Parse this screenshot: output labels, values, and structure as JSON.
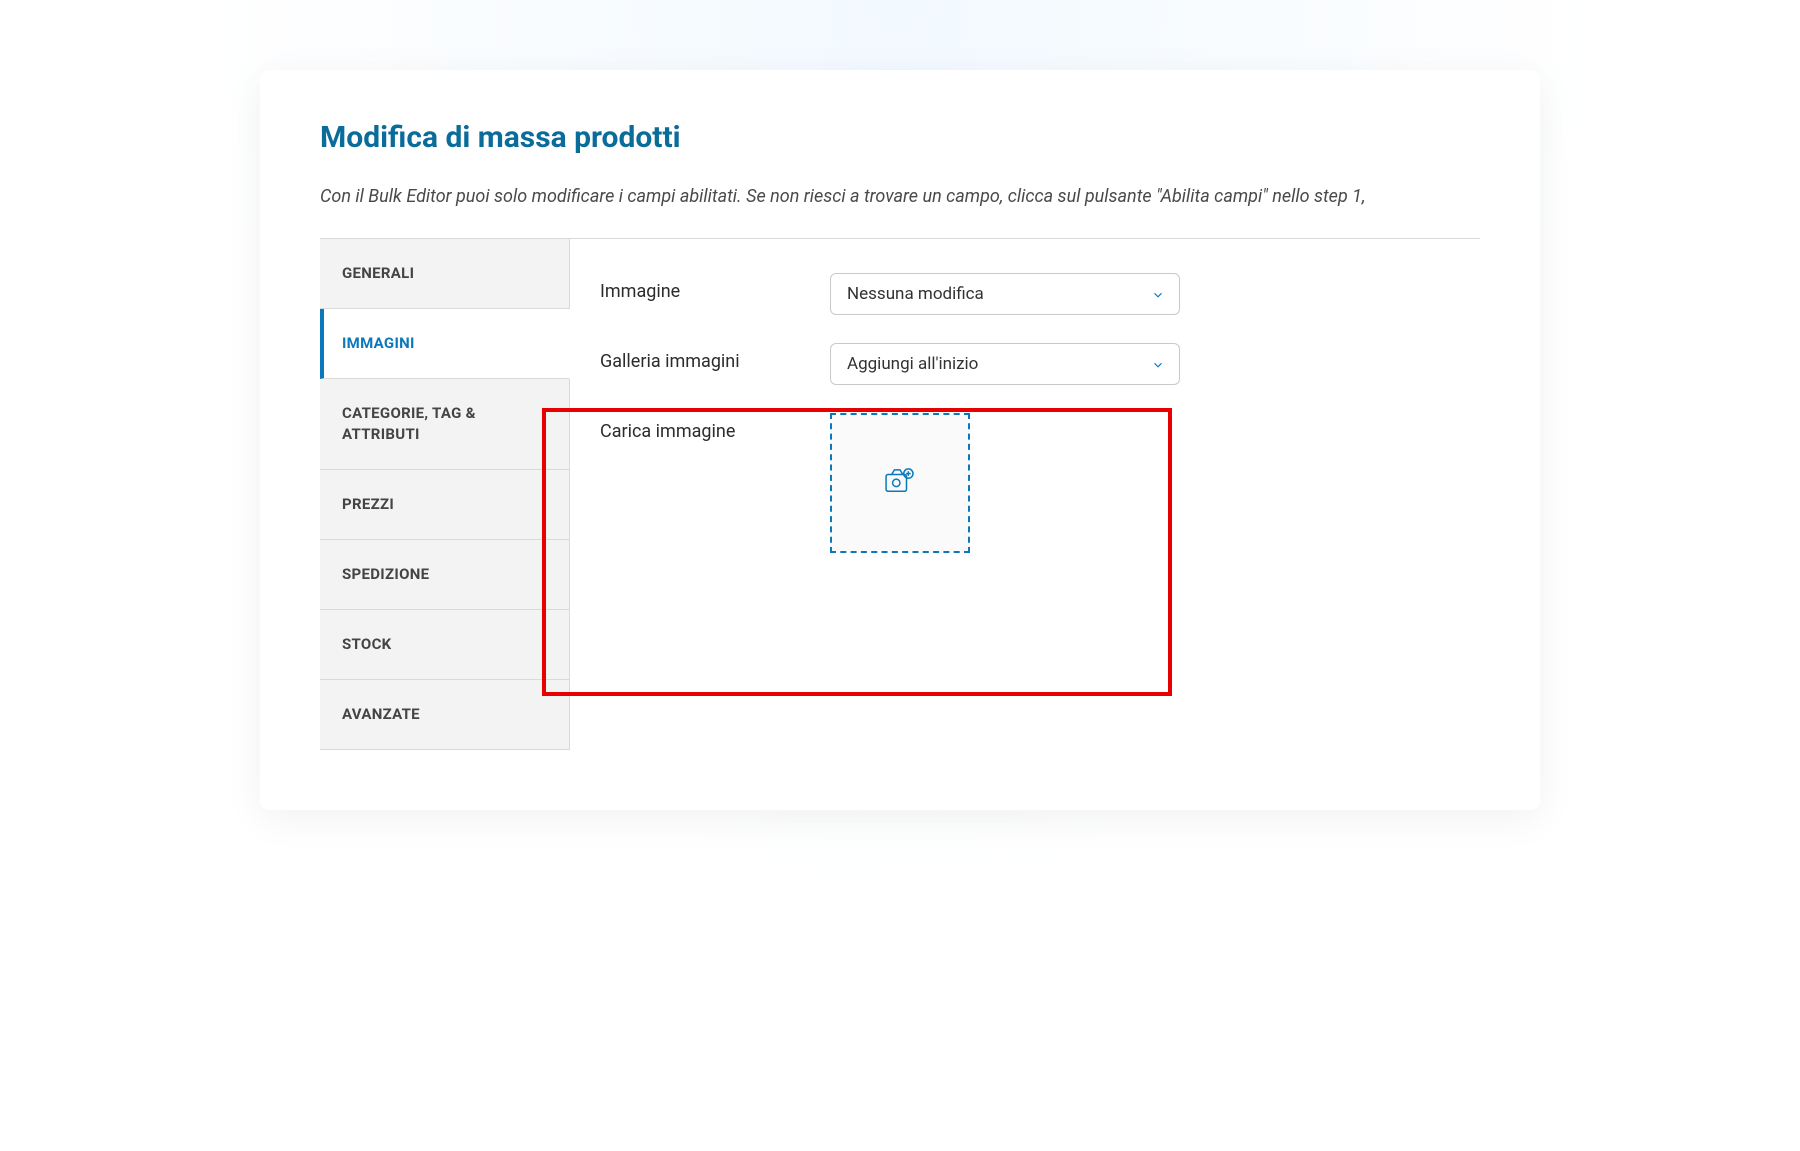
{
  "page": {
    "title": "Modifica di massa prodotti",
    "subtitle": "Con il Bulk Editor puoi solo modificare i campi abilitati. Se non riesci a trovare un campo, clicca sul pulsante \"Abilita campi\" nello step 1,"
  },
  "tabs": [
    {
      "label": "GENERALI",
      "active": false
    },
    {
      "label": "IMMAGINI",
      "active": true
    },
    {
      "label": "CATEGORIE, TAG & ATTRIBUTI",
      "active": false
    },
    {
      "label": "PREZZI",
      "active": false
    },
    {
      "label": "SPEDIZIONE",
      "active": false
    },
    {
      "label": "STOCK",
      "active": false
    },
    {
      "label": "AVANZATE",
      "active": false
    }
  ],
  "fields": {
    "image": {
      "label": "Immagine",
      "value": "Nessuna modifica"
    },
    "gallery": {
      "label": "Galleria immagini",
      "value": "Aggiungi all'inizio"
    },
    "upload": {
      "label": "Carica immagine"
    }
  },
  "colors": {
    "accent": "#0a78ba",
    "title": "#0a6c9a",
    "highlight": "#e60000"
  }
}
